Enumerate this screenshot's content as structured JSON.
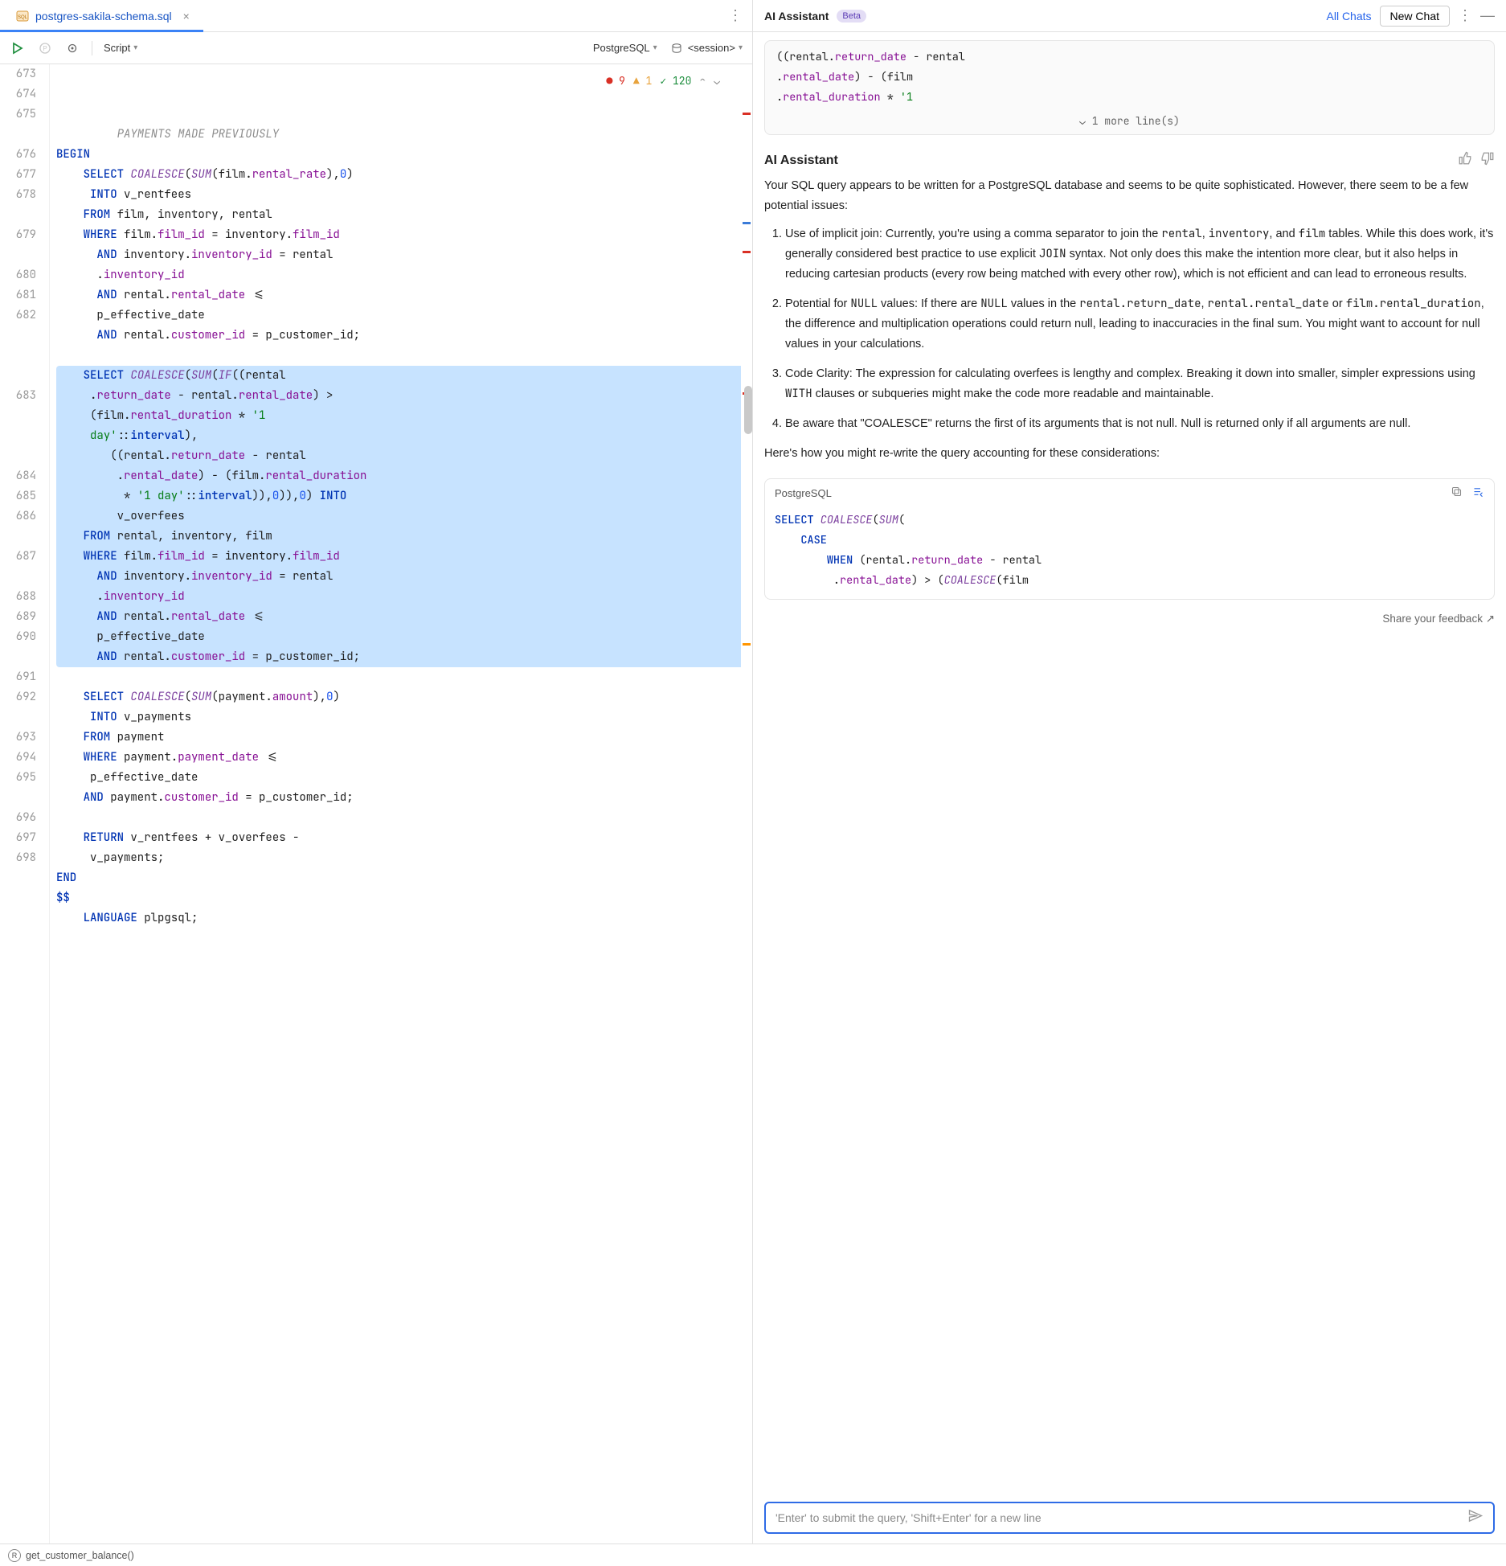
{
  "tab": {
    "filename": "postgres-sakila-schema.sql"
  },
  "toolbar": {
    "script_label": "Script",
    "dialect": "PostgreSQL",
    "session": "<session>"
  },
  "inspections": {
    "errors": 9,
    "warnings": 1,
    "ok": 120
  },
  "code_lines": [
    {
      "n": 673,
      "cls": "",
      "html": "         <span class=\"cmt\">PAYMENTS MADE PREVIOUSLY</span>"
    },
    {
      "n": 674,
      "cls": "",
      "html": "<span class=\"kw\">BEGIN</span>"
    },
    {
      "n": 675,
      "cls": "",
      "html": "    <span class=\"kw\">SELECT</span> <span class=\"fn\">COALESCE</span>(<span class=\"fn\">SUM</span>(film.<span class=\"col\">rental_rate</span>),<span class=\"num\">0</span>)"
    },
    {
      "n": "",
      "cls": "",
      "html": "     <span class=\"kw\">INTO</span> v_rentfees"
    },
    {
      "n": 676,
      "cls": "",
      "html": "    <span class=\"kw\">FROM</span> film, inventory, rental"
    },
    {
      "n": 677,
      "cls": "",
      "html": "    <span class=\"kw\">WHERE</span> film.<span class=\"col\">film_id</span> = inventory.<span class=\"col\">film_id</span>"
    },
    {
      "n": 678,
      "cls": "",
      "html": "      <span class=\"kw\">AND</span> inventory.<span class=\"col\">inventory_id</span> = rental"
    },
    {
      "n": "",
      "cls": "",
      "html": "      .<span class=\"col\">inventory_id</span>"
    },
    {
      "n": 679,
      "cls": "",
      "html": "      <span class=\"kw\">AND</span> rental.<span class=\"col\">rental_date</span> &lt;="
    },
    {
      "n": "",
      "cls": "",
      "html": "      p_effective_date"
    },
    {
      "n": 680,
      "cls": "",
      "html": "      <span class=\"kw\">AND</span> rental.<span class=\"col\">customer_id</span> = p_customer_id;"
    },
    {
      "n": 681,
      "cls": "",
      "html": ""
    },
    {
      "n": 682,
      "cls": "sel sel-first",
      "html": "    <span class=\"kw\">SELECT</span> <span class=\"fn\">COALESCE</span>(<span class=\"fn\">SUM</span>(<span class=\"fn\">IF</span>((rental"
    },
    {
      "n": "",
      "cls": "sel",
      "html": "     .<span class=\"col\">return_date</span> - rental.<span class=\"col\">rental_date</span>) &gt;"
    },
    {
      "n": "",
      "cls": "sel",
      "html": "     (film.<span class=\"col\">rental_duration</span> * <span class=\"str\">'1</span>"
    },
    {
      "n": "",
      "cls": "sel",
      "html": "     <span class=\"str\">day'</span>::<span class=\"kw\">interval</span>),"
    },
    {
      "n": 683,
      "cls": "sel",
      "html": "        ((rental.<span class=\"col\">return_date</span> - rental"
    },
    {
      "n": "",
      "cls": "sel",
      "html": "         .<span class=\"col\">rental_date</span>) - (film.<span class=\"col\">rental_duration</span>"
    },
    {
      "n": "",
      "cls": "sel",
      "html": "          * <span class=\"str\">'1 day'</span>::<span class=\"kw\">interval</span>)),<span class=\"num\">0</span>)),<span class=\"num\">0</span>) <span class=\"kw\">INTO</span>"
    },
    {
      "n": "",
      "cls": "sel",
      "html": "         v_overfees"
    },
    {
      "n": 684,
      "cls": "sel",
      "html": "    <span class=\"kw\">FROM</span> rental, inventory, film"
    },
    {
      "n": 685,
      "cls": "sel",
      "html": "    <span class=\"kw\">WHERE</span> film.<span class=\"col\">film_id</span> = inventory.<span class=\"col\">film_id</span>"
    },
    {
      "n": 686,
      "cls": "sel",
      "html": "      <span class=\"kw\">AND</span> inventory.<span class=\"col\">inventory_id</span> = rental"
    },
    {
      "n": "",
      "cls": "sel",
      "html": "      .<span class=\"col\">inventory_id</span>"
    },
    {
      "n": 687,
      "cls": "sel",
      "html": "      <span class=\"kw\">AND</span> rental.<span class=\"col\">rental_date</span> &lt;="
    },
    {
      "n": "",
      "cls": "sel",
      "html": "      p_effective_date"
    },
    {
      "n": 688,
      "cls": "sel sel-last",
      "html": "      <span class=\"kw\">AND</span> rental.<span class=\"col\">customer_id</span> = p_customer_id;"
    },
    {
      "n": 689,
      "cls": "",
      "html": ""
    },
    {
      "n": 690,
      "cls": "",
      "html": "    <span class=\"kw\">SELECT</span> <span class=\"fn\">COALESCE</span>(<span class=\"fn\">SUM</span>(payment.<span class=\"col\">amount</span>),<span class=\"num\">0</span>)"
    },
    {
      "n": "",
      "cls": "",
      "html": "     <span class=\"kw\">INTO</span> v_payments"
    },
    {
      "n": 691,
      "cls": "",
      "html": "    <span class=\"kw\">FROM</span> payment"
    },
    {
      "n": 692,
      "cls": "",
      "html": "    <span class=\"kw\">WHERE</span> payment.<span class=\"col\">payment_date</span> &lt;="
    },
    {
      "n": "",
      "cls": "",
      "html": "     p_effective_date"
    },
    {
      "n": 693,
      "cls": "",
      "html": "    <span class=\"kw\">AND</span> payment.<span class=\"col\">customer_id</span> = p_customer_id;"
    },
    {
      "n": 694,
      "cls": "",
      "html": ""
    },
    {
      "n": 695,
      "cls": "",
      "html": "    <span class=\"kw\">RETURN</span> v_rentfees + v_overfees -"
    },
    {
      "n": "",
      "cls": "",
      "html": "     v_payments;"
    },
    {
      "n": 696,
      "cls": "",
      "html": "<span class=\"kw\">END</span>"
    },
    {
      "n": 697,
      "cls": "",
      "html": "<span class=\"kw\">$$</span>"
    },
    {
      "n": 698,
      "cls": "",
      "html": "    <span class=\"kw\">LANGUAGE</span> plpgsql;"
    }
  ],
  "ai": {
    "header": {
      "title": "AI Assistant",
      "badge": "Beta",
      "all_chats": "All Chats",
      "new_chat": "New Chat"
    },
    "prev_code": [
      "           ((rental.<span class=\"col\">return_date</span> - rental",
      "            .<span class=\"col\">rental_date</span>) - (film",
      "            .<span class=\"col\">rental_duration</span> * <span class=\"str\">'1</span>"
    ],
    "prev_more": "1 more line(s)",
    "resp_title": "AI Assistant",
    "intro": "Your SQL query appears to be written for a PostgreSQL database and seems to be quite sophisticated. However, there seem to be a few potential issues:",
    "items": [
      "Use of implicit join: Currently, you're using a comma separator to join the <span class=\"mono\">rental</span>, <span class=\"mono\">inventory</span>, and <span class=\"mono\">film</span> tables. While this does work, it's generally considered best practice to use explicit <span class=\"mono\">JOIN</span> syntax. Not only does this make the intention more clear, but it also helps in reducing cartesian products (every row being matched with every other row), which is not efficient and can lead to erroneous results.",
      "Potential for <span class=\"mono\">NULL</span> values: If there are <span class=\"mono\">NULL</span> values in the <span class=\"mono\">rental.return_date</span>, <span class=\"mono\">rental.rental_date</span> or <span class=\"mono\">film.rental_duration</span>, the difference and multiplication operations could return null, leading to inaccuracies in the final sum. You might want to account for null values in your calculations.",
      "Code Clarity: The expression for calculating overfees is lengthy and complex. Breaking it down into smaller, simpler expressions using <span class=\"mono\">WITH</span> clauses or subqueries might make the code more readable and maintainable.",
      "Be aware that \"COALESCE\" returns the first of its arguments that is not null. Null is returned only if all arguments are null."
    ],
    "outro": "Here's how you might re-write the query accounting for these considerations:",
    "code_block": {
      "lang": "PostgreSQL",
      "body": "<span class=\"kw\">SELECT</span> <span class=\"fn\">COALESCE</span>(<span class=\"fn\">SUM</span>(\n    <span class=\"kw\">CASE</span>\n        <span class=\"kw\">WHEN</span> (rental.<span class=\"col\">return_date</span> - rental\n         .<span class=\"col\">rental_date</span>) &gt; (<span class=\"fn\">COALESCE</span>(film"
    },
    "feedback": "Share your feedback ↗",
    "input_placeholder": "'Enter' to submit the query, 'Shift+Enter' for a new line"
  },
  "status": {
    "context": "get_customer_balance()"
  }
}
